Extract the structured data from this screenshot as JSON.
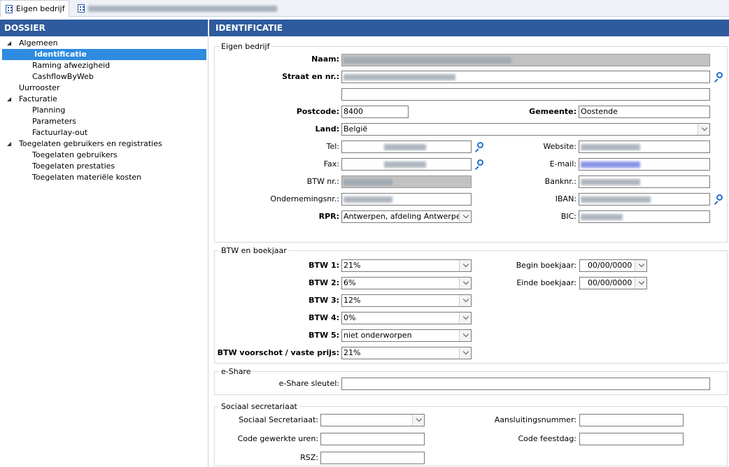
{
  "tabs": [
    {
      "label": "Eigen bedrijf",
      "active": true
    },
    {
      "label": "",
      "active": false
    }
  ],
  "left_panel": {
    "title": "DOSSIER",
    "tree": [
      {
        "label": "Algemeen",
        "level": 1,
        "expanded": true
      },
      {
        "label": "Identificatie",
        "level": 2,
        "selected": true
      },
      {
        "label": "Raming afwezigheid",
        "level": 2
      },
      {
        "label": "CashflowByWeb",
        "level": 2
      },
      {
        "label": "Uurrooster",
        "level": 1
      },
      {
        "label": "Facturatie",
        "level": 1,
        "expanded": true
      },
      {
        "label": "Planning",
        "level": 2
      },
      {
        "label": "Parameters",
        "level": 2
      },
      {
        "label": "Factuurlay-out",
        "level": 2
      },
      {
        "label": "Toegelaten gebruikers en registraties",
        "level": 1,
        "expanded": true
      },
      {
        "label": "Toegelaten gebruikers",
        "level": 2
      },
      {
        "label": "Toegelaten prestaties",
        "level": 2
      },
      {
        "label": "Toegelaten materiële kosten",
        "level": 2
      }
    ]
  },
  "right_panel": {
    "title": "IDENTIFICATIE",
    "eigen_bedrijf": {
      "legend": "Eigen bedrijf",
      "naam_label": "Naam:",
      "straat_label": "Straat en nr.:",
      "postcode_label": "Postcode:",
      "postcode_value": "8400",
      "gemeente_label": "Gemeente:",
      "gemeente_value": "Oostende",
      "land_label": "Land:",
      "land_value": "België",
      "tel_label": "Tel:",
      "website_label": "Website:",
      "fax_label": "Fax:",
      "email_label": "E-mail:",
      "btwnr_label": "BTW nr.:",
      "banknr_label": "Banknr.:",
      "ondernemingsnr_label": "Ondernemingsnr.:",
      "iban_label": "IBAN:",
      "rpr_label": "RPR:",
      "rpr_value": "Antwerpen, afdeling Antwerpen",
      "bic_label": "BIC:"
    },
    "btw": {
      "legend": "BTW en boekjaar",
      "btw1_label": "BTW 1:",
      "btw1_value": "21%",
      "btw2_label": "BTW 2:",
      "btw2_value": "6%",
      "btw3_label": "BTW 3:",
      "btw3_value": "12%",
      "btw4_label": "BTW 4:",
      "btw4_value": "0%",
      "btw5_label": "BTW 5:",
      "btw5_value": "niet onderworpen",
      "voorschot_label": "BTW voorschot / vaste prijs:",
      "voorschot_value": "21%",
      "begin_label": "Begin boekjaar:",
      "begin_value": "00/00/0000",
      "einde_label": "Einde boekjaar:",
      "einde_value": "00/00/0000"
    },
    "eshare": {
      "legend": "e-Share",
      "sleutel_label": "e-Share sleutel:",
      "sleutel_value": ""
    },
    "sociaal": {
      "legend": "Sociaal secretariaat",
      "secretariaat_label": "Sociaal Secretariaat:",
      "secretariaat_value": "",
      "aansluiting_label": "Aansluitingsnummer:",
      "aansluiting_value": "",
      "uren_label": "Code gewerkte uren:",
      "uren_value": "",
      "feestdag_label": "Code feestdag:",
      "feestdag_value": "",
      "rsz_label": "RSZ:",
      "rsz_value": ""
    }
  },
  "colors": {
    "header_bg": "#2e5b9e",
    "selected_bg": "#2e8be0",
    "lookup_icon": "#1f6fd0"
  },
  "icons": [
    "building-icon",
    "expand-arrow-icon",
    "search-icon",
    "chevron-down-icon"
  ]
}
